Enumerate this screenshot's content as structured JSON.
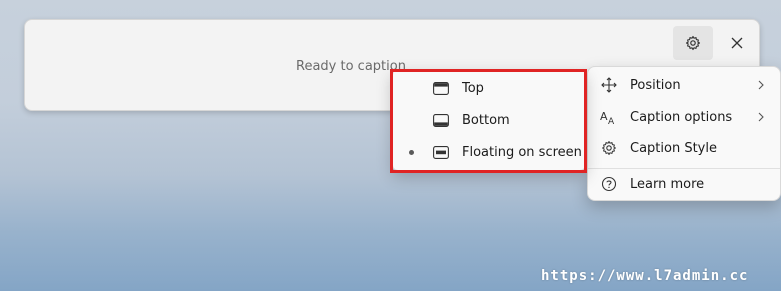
{
  "caption_window": {
    "status_text": "Ready to caption",
    "settings_icon": "gear-icon",
    "close_icon": "close-icon"
  },
  "settings_menu": {
    "items": [
      {
        "label": "Position",
        "icon": "move-arrows-icon",
        "has_submenu": true
      },
      {
        "label": "Caption options",
        "icon": "font-size-icon",
        "has_submenu": true
      },
      {
        "label": "Caption Style",
        "icon": "gear-icon",
        "has_submenu": false
      },
      {
        "label": "Learn more",
        "icon": "help-icon",
        "has_submenu": false
      }
    ]
  },
  "position_submenu": {
    "items": [
      {
        "label": "Top",
        "icon": "window-top-icon",
        "selected": false
      },
      {
        "label": "Bottom",
        "icon": "window-bottom-icon",
        "selected": false
      },
      {
        "label": "Floating on screen",
        "icon": "window-floating-icon",
        "selected": true
      }
    ]
  },
  "watermark": {
    "text": "https://www.l7admin.cc"
  },
  "colors": {
    "highlight": "#e02424",
    "menu_bg": "#f9f9f9"
  }
}
